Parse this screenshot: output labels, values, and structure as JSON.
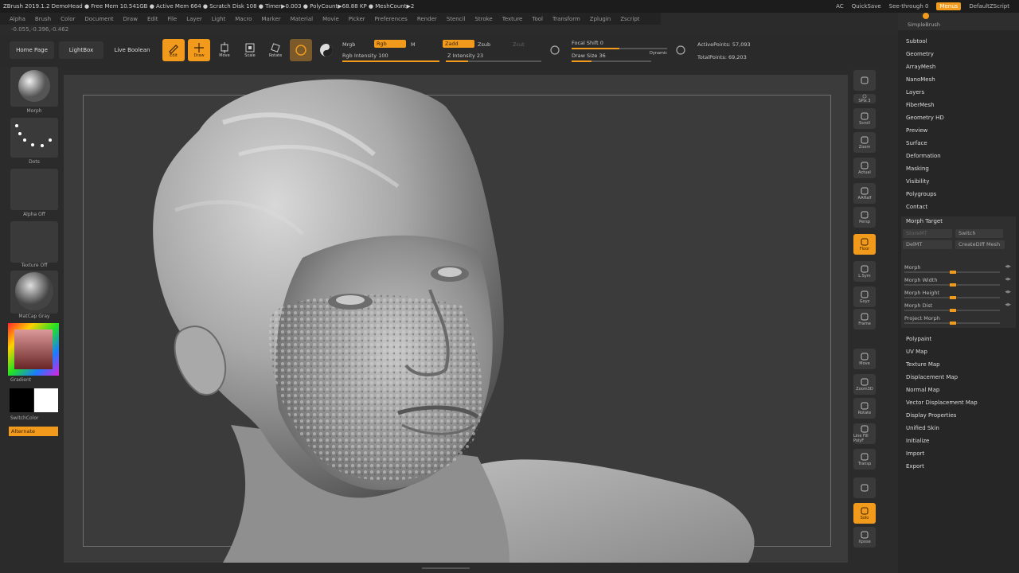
{
  "titlebar": {
    "info": "ZBrush 2019.1.2   DemoHead   ● Free Mem 10.541GB ● Active Mem 664 ● Scratch Disk 108 ● Timer▶0.003 ● PolyCount▶68.88 KP ● MeshCount▶2",
    "ac": "AC",
    "quicksave": "QuickSave",
    "see_through": "See-through  0",
    "menus": "Menus",
    "default_zscript": "DefaultZScript"
  },
  "menubar": [
    "Alpha",
    "Brush",
    "Color",
    "Document",
    "Draw",
    "Edit",
    "File",
    "Layer",
    "Light",
    "Macro",
    "Marker",
    "Material",
    "Movie",
    "Picker",
    "Preferences",
    "Render",
    "Stencil",
    "Stroke",
    "Texture",
    "Tool",
    "Transform",
    "Zplugin",
    "Zscript"
  ],
  "coords": "-0.055,-0.396,-0.462",
  "toolbar": {
    "home_page": "Home Page",
    "lightbox": "LightBox",
    "live_boolean": "Live Boolean",
    "edit": "Edit",
    "draw": "Draw",
    "move": "Move",
    "scale": "Scale",
    "rotate": "Rotate",
    "mrgb": "Mrgb",
    "rgb": "Rgb",
    "m": "M",
    "rgb_intensity": "Rgb Intensity 100",
    "zadd": "Zadd",
    "zsub": "Zsub",
    "zcut": "Zcut",
    "z_intensity": "Z Intensity 23",
    "focal_shift": "Focal Shift 0",
    "draw_size": "Draw Size 36",
    "dynamic": "Dynamic",
    "active_points": "ActivePoints: 57,093",
    "total_points": "TotalPoints: 69,203"
  },
  "leftbar": {
    "brush": "Morph",
    "stroke": "Dots",
    "alpha": "Alpha Off",
    "texture": "Texture Off",
    "material": "MatCap Gray",
    "gradient": "Gradient",
    "switch_color": "SwitchColor",
    "alternate": "Alternate"
  },
  "rightbar": [
    {
      "name": "bpr-button",
      "label": ""
    },
    {
      "name": "spix-button",
      "label": "SPix 3"
    },
    {
      "name": "scroll-button",
      "label": "Scroll"
    },
    {
      "name": "zoom-button",
      "label": "Zoom"
    },
    {
      "name": "actual-button",
      "label": "Actual"
    },
    {
      "name": "aahalf-button",
      "label": "AAHalf"
    },
    {
      "name": "persp-button",
      "label": "Persp"
    },
    {
      "name": "floor-button",
      "label": "Floor"
    },
    {
      "name": "lsym-button",
      "label": "L.Sym"
    },
    {
      "name": "gxyz-button",
      "label": "Gxyz"
    },
    {
      "name": "frame-button",
      "label": "Frame"
    },
    {
      "name": "move-button",
      "label": "Move"
    },
    {
      "name": "zoom3d-button",
      "label": "Zoom3D"
    },
    {
      "name": "rotate-button",
      "label": "Rotate"
    },
    {
      "name": "linefill-button",
      "label": "Line Fill PolyF"
    },
    {
      "name": "transp-button",
      "label": "Transp"
    },
    {
      "name": "ghost-button",
      "label": ""
    },
    {
      "name": "solo-button",
      "label": "Solo"
    },
    {
      "name": "xpose-button",
      "label": "Xpose"
    }
  ],
  "panel": {
    "simple_brush": "SimpleBrush",
    "items_top": [
      "Subtool",
      "Geometry",
      "ArrayMesh",
      "NanoMesh",
      "Layers",
      "FiberMesh",
      "Geometry HD",
      "Preview",
      "Surface",
      "Deformation",
      "Masking",
      "Visibility",
      "Polygroups",
      "Contact"
    ],
    "morph_target": {
      "title": "Morph Target",
      "storemt": "StoreMT",
      "switch": "Switch",
      "delmt": "DelMT",
      "creatediff": "CreateDiff Mesh",
      "sliders": [
        {
          "label": "Morph",
          "value": "◀▶"
        },
        {
          "label": "Morph Width",
          "value": "◀▶"
        },
        {
          "label": "Morph Height",
          "value": "◀▶"
        },
        {
          "label": "Morph Dist",
          "value": "◀▶"
        },
        {
          "label": "Project Morph",
          "value": ""
        }
      ]
    },
    "items_bottom": [
      "Polypaint",
      "UV Map",
      "Texture Map",
      "Displacement Map",
      "Normal Map",
      "Vector Displacement Map",
      "Display Properties",
      "Unified Skin",
      "Initialize",
      "Import",
      "Export"
    ]
  },
  "colors": {
    "accent": "#f29a1b",
    "bg": "#2b2b2b",
    "canvas": "#3b3b3b"
  }
}
